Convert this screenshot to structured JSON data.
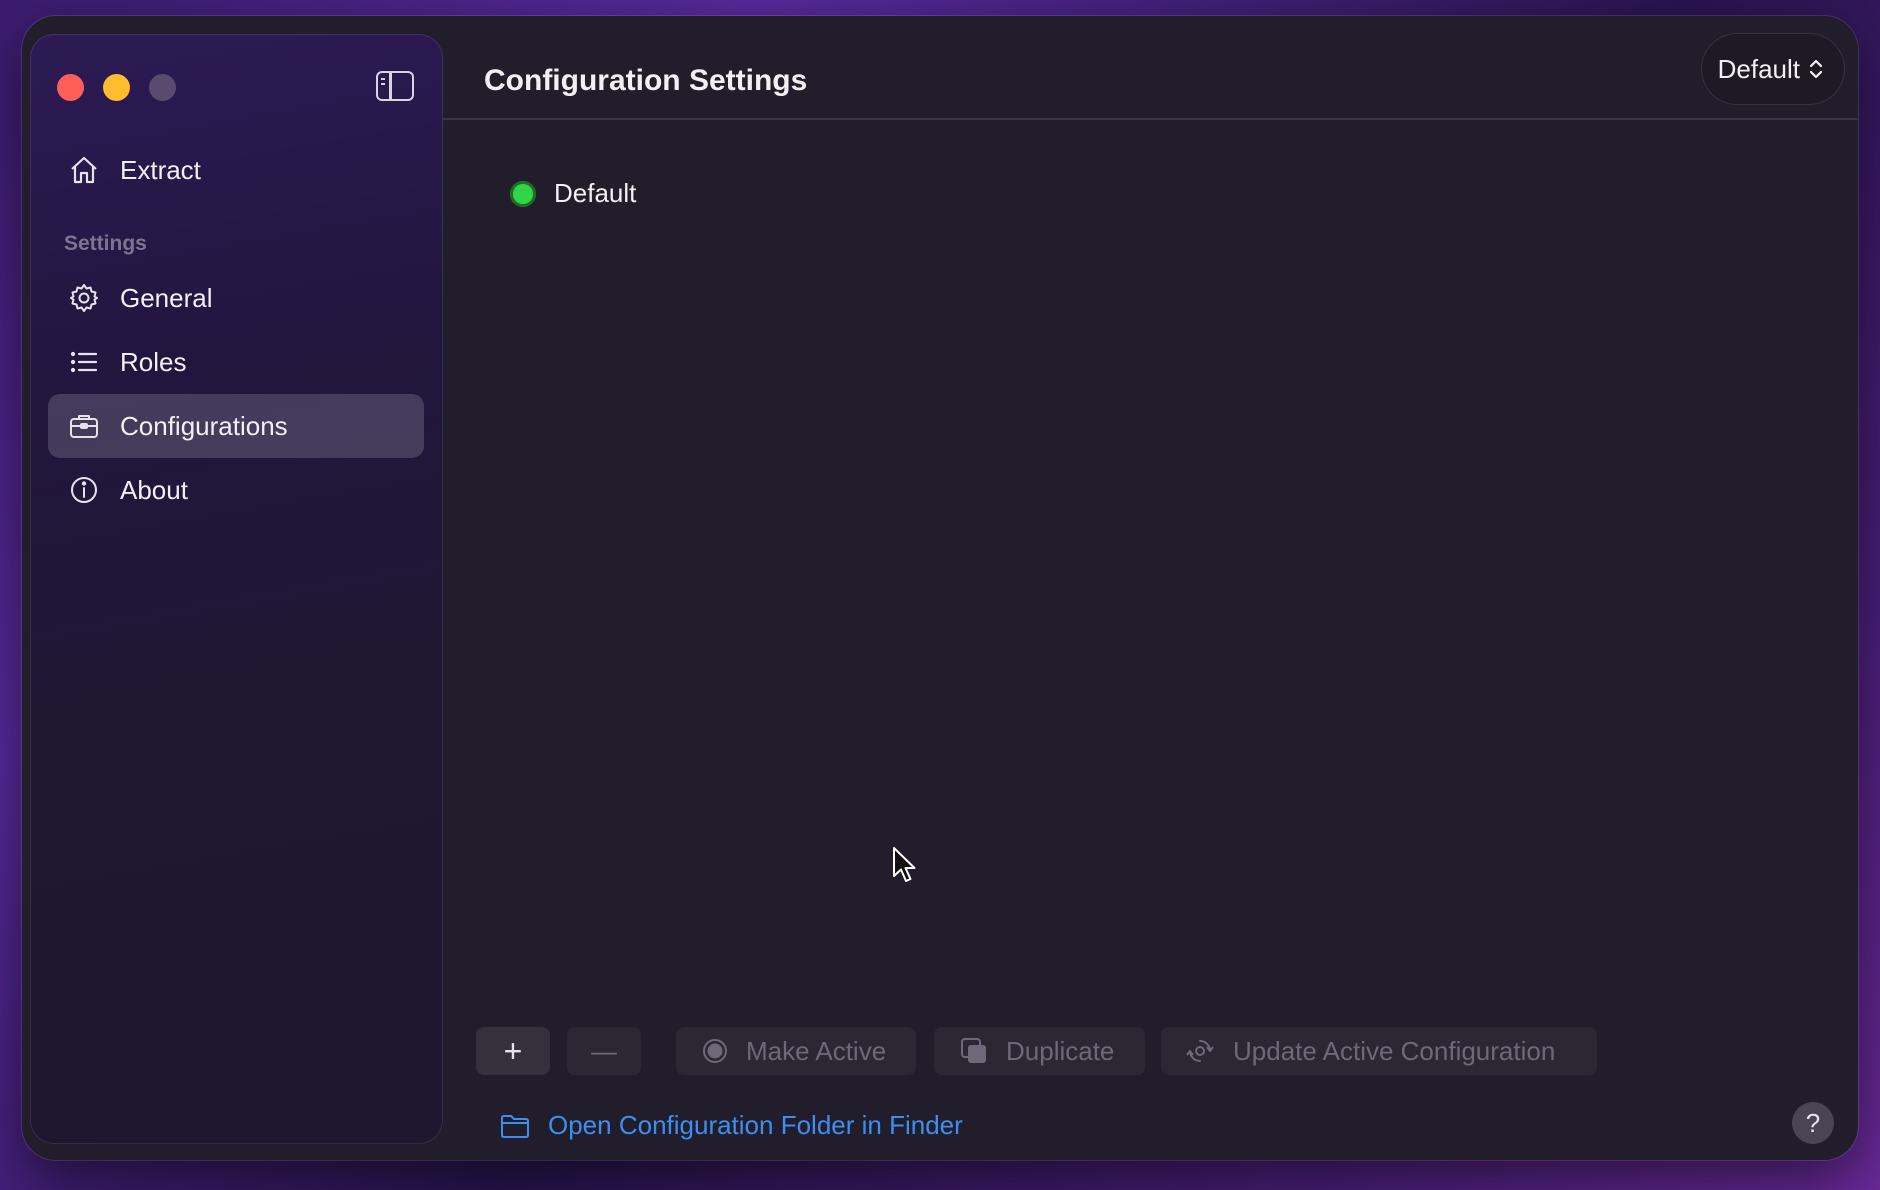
{
  "window": {
    "title": "Configuration Settings",
    "config_picker_value": "Default"
  },
  "sidebar": {
    "top_item": {
      "label": "Extract",
      "icon": "house-icon"
    },
    "section_label": "Settings",
    "items": [
      {
        "label": "General",
        "icon": "gear-icon",
        "active": false
      },
      {
        "label": "Roles",
        "icon": "list-icon",
        "active": false
      },
      {
        "label": "Configurations",
        "icon": "briefcase-icon",
        "active": true
      },
      {
        "label": "About",
        "icon": "info-icon",
        "active": false
      }
    ]
  },
  "configurations": [
    {
      "name": "Default",
      "active": true,
      "status_color": "#31d547"
    }
  ],
  "toolbar": {
    "add_label": "+",
    "remove_label": "—",
    "make_active_label": "Make Active",
    "duplicate_label": "Duplicate",
    "update_label": "Update Active Configuration"
  },
  "footer": {
    "finder_link_label": "Open Configuration Folder in Finder",
    "help_label": "?"
  },
  "colors": {
    "accent_link": "#3d8ef0",
    "traffic_close": "#ff5f57",
    "traffic_minimize": "#febc2e"
  }
}
